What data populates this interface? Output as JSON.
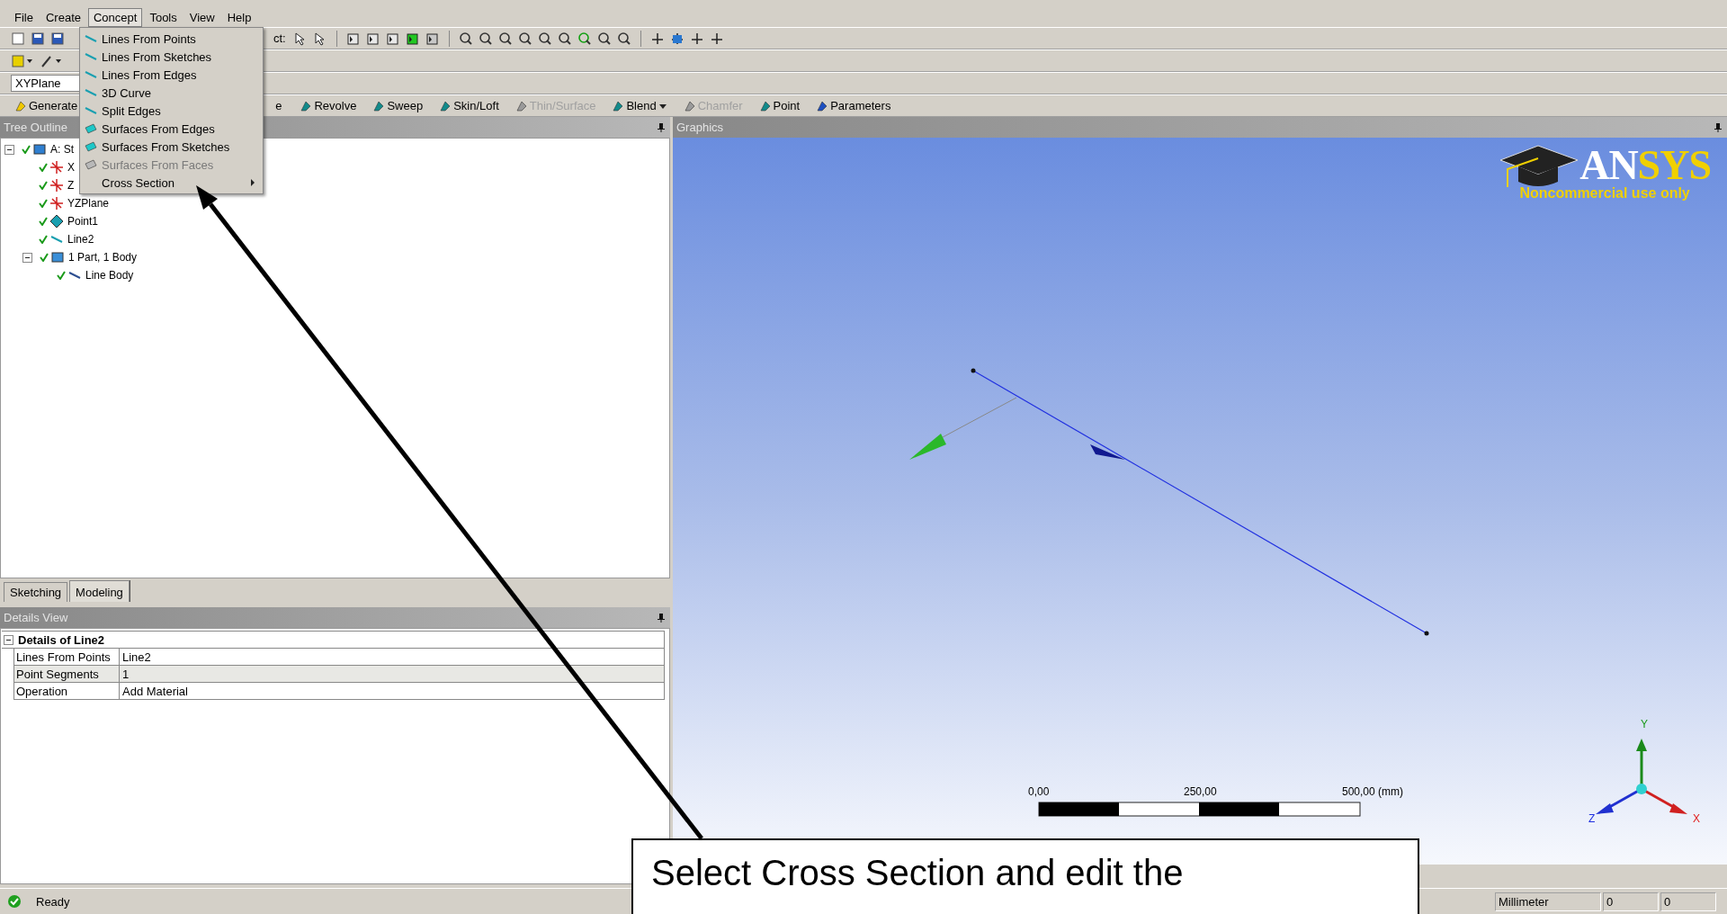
{
  "menu_bar": [
    {
      "label": "File",
      "selected": false
    },
    {
      "label": "Create",
      "selected": false
    },
    {
      "label": "Concept",
      "selected": true
    },
    {
      "label": "Tools",
      "selected": false
    },
    {
      "label": "View",
      "selected": false
    },
    {
      "label": "Help",
      "selected": false
    }
  ],
  "concept_menu": [
    {
      "label": "Lines From Points",
      "kind": "line",
      "disabled": false,
      "submenu": false
    },
    {
      "label": "Lines From Sketches",
      "kind": "sketch-line",
      "disabled": false,
      "submenu": false
    },
    {
      "label": "Lines From Edges",
      "kind": "edge-line",
      "disabled": false,
      "submenu": false
    },
    {
      "label": "3D Curve",
      "kind": "curve",
      "disabled": false,
      "submenu": false
    },
    {
      "label": "Split Edges",
      "kind": "split",
      "disabled": false,
      "submenu": false
    },
    {
      "label": "Surfaces From Edges",
      "kind": "surface",
      "disabled": false,
      "submenu": false
    },
    {
      "label": "Surfaces From Sketches",
      "kind": "sketch-surface",
      "disabled": false,
      "submenu": false
    },
    {
      "label": "Surfaces From Faces",
      "kind": "face-surface",
      "disabled": true,
      "submenu": false
    },
    {
      "label": "Cross Section",
      "kind": "none",
      "disabled": false,
      "submenu": true
    }
  ],
  "toolbar": {
    "select_label": "ct:"
  },
  "plane_field": {
    "value": "XYPlane"
  },
  "features": [
    {
      "label": "Generate",
      "kind": "generate",
      "disabled": false,
      "dropdown": false
    },
    {
      "label": "e",
      "kind": "none",
      "disabled": false,
      "dropdown": false
    },
    {
      "label": "Revolve",
      "kind": "revolve",
      "disabled": false,
      "dropdown": false
    },
    {
      "label": "Sweep",
      "kind": "sweep",
      "disabled": false,
      "dropdown": false
    },
    {
      "label": "Skin/Loft",
      "kind": "loft",
      "disabled": false,
      "dropdown": false
    },
    {
      "label": "Thin/Surface",
      "kind": "thin",
      "disabled": true,
      "dropdown": false
    },
    {
      "label": "Blend",
      "kind": "blend",
      "disabled": false,
      "dropdown": true
    },
    {
      "label": "Chamfer",
      "kind": "chamfer",
      "disabled": true,
      "dropdown": false
    },
    {
      "label": "Point",
      "kind": "point",
      "disabled": false,
      "dropdown": false
    },
    {
      "label": "Parameters",
      "kind": "parameters",
      "disabled": false,
      "dropdown": false
    }
  ],
  "tree_panel": {
    "title": "Tree Outline",
    "items": [
      {
        "label": "A: St",
        "kind": "root",
        "expanded": true,
        "children": [
          {
            "label": "X",
            "kind": "plane"
          },
          {
            "label": "Z",
            "kind": "plane"
          },
          {
            "label": "YZPlane",
            "kind": "plane"
          },
          {
            "label": "Point1",
            "kind": "point"
          },
          {
            "label": "Line2",
            "kind": "line"
          },
          {
            "label": "1 Part, 1 Body",
            "kind": "part",
            "expanded": true,
            "children": [
              {
                "label": "Line Body",
                "kind": "body"
              }
            ]
          }
        ]
      }
    ]
  },
  "tabs": [
    {
      "label": "Sketching",
      "selected": false
    },
    {
      "label": "Modeling",
      "selected": true
    }
  ],
  "details_panel": {
    "title": "Details View",
    "heading": "Details of Line2",
    "expanded": true,
    "rows": [
      {
        "name": "Lines From Points",
        "value": "Line2"
      },
      {
        "name": "Point Segments",
        "value": "1"
      },
      {
        "name": "Operation",
        "value": "Add Material"
      }
    ]
  },
  "graphics": {
    "title": "Graphics",
    "logo_parts": [
      "AN",
      "SYS"
    ],
    "logo_note": "Noncommercial use only",
    "scale_labels": [
      "0,00",
      "250,00",
      "500,00 (mm)"
    ],
    "triad": {
      "x": "X",
      "y": "Y",
      "z": "Z"
    }
  },
  "status_bar": {
    "message": "Ready",
    "fields": [
      "Millimeter",
      "0",
      "0"
    ]
  },
  "callout": {
    "text": "Select Cross Section and edit the"
  }
}
